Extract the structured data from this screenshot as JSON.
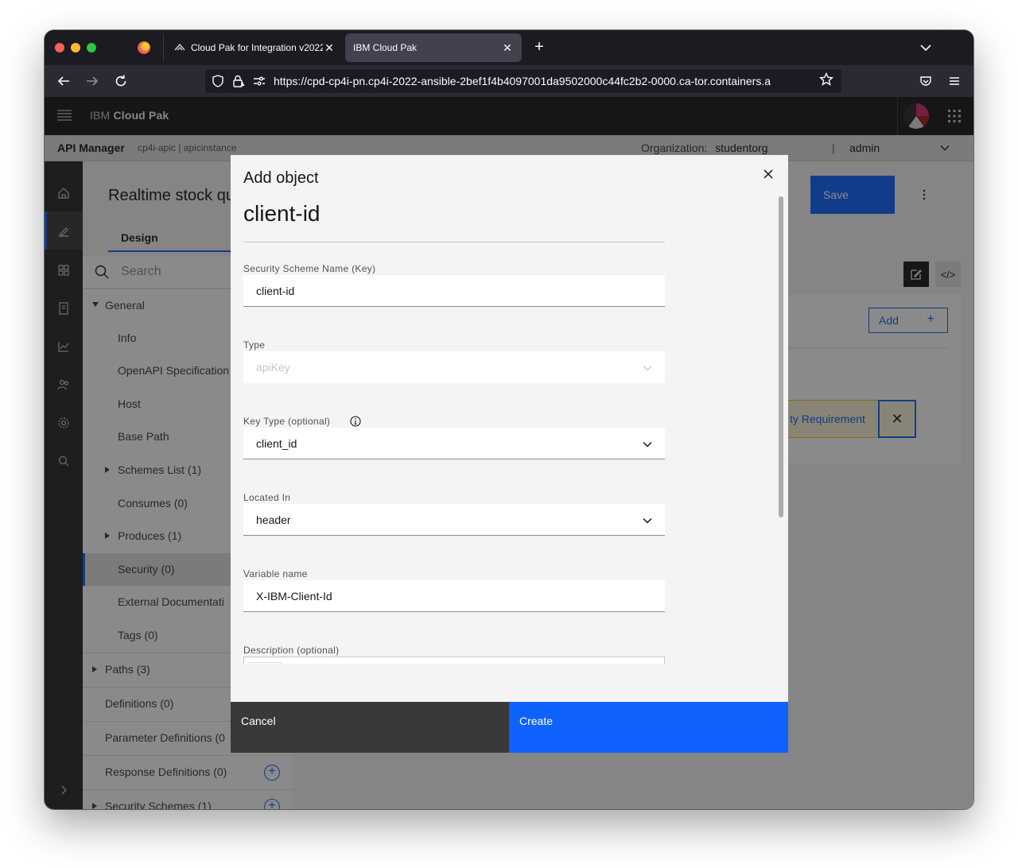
{
  "browser": {
    "tabs": [
      {
        "title": "Cloud Pak for Integration v2022",
        "active": false
      },
      {
        "title": "IBM Cloud Pak",
        "active": true
      }
    ],
    "url": "https://cpd-cp4i-pn.cp4i-2022-ansible-2bef1f4b4097001da9502000c44fc2b2-0000.ca-tor.containers.a"
  },
  "app": {
    "brand_prefix": "IBM",
    "brand_name": "Cloud Pak",
    "sub_header": {
      "app_name": "API Manager",
      "crumbs": "cp4i-apic  |  apicinstance",
      "org_label": "Organization:",
      "org_value": "studentorg",
      "pipe": "|",
      "user": "admin"
    },
    "page_title": "Realtime stock qu",
    "design_tab": "Design",
    "save_label": "Save",
    "search_placeholder": "Search",
    "nav": [
      {
        "label": "General",
        "level": 0,
        "caret": "down"
      },
      {
        "label": "Info",
        "level": 1
      },
      {
        "label": "OpenAPI Specification",
        "level": 1
      },
      {
        "label": "Host",
        "level": 1
      },
      {
        "label": "Base Path",
        "level": 1
      },
      {
        "label": "Schemes List (1)",
        "level": 1,
        "caret": "right"
      },
      {
        "label": "Consumes (0)",
        "level": 1
      },
      {
        "label": "Produces (1)",
        "level": 1,
        "caret": "right"
      },
      {
        "label": "Security (0)",
        "level": 1,
        "selected": true
      },
      {
        "label": "External Documentati",
        "level": 1
      },
      {
        "label": "Tags (0)",
        "level": 1
      },
      {
        "label": "Paths (3)",
        "level": 0,
        "caret": "right"
      },
      {
        "label": "Definitions (0)",
        "level": 0
      },
      {
        "label": "Parameter Definitions (0",
        "level": 0
      },
      {
        "label": "Response Definitions (0)",
        "level": 0,
        "add": true
      },
      {
        "label": "Security Schemes (1)",
        "level": 0,
        "caret": "right",
        "add": true
      }
    ],
    "add_label": "Add",
    "add_plus": "+",
    "requirement_label": "ty Requirement",
    "requirement_close": "✕"
  },
  "modal": {
    "label": "Add object",
    "heading": "client-id",
    "fields": {
      "scheme_name": {
        "label": "Security Scheme Name (Key)",
        "value": "client-id"
      },
      "type": {
        "label": "Type",
        "value": "apiKey"
      },
      "key_type": {
        "label": "Key Type (optional)",
        "value": "client_id"
      },
      "located_in": {
        "label": "Located In",
        "value": "header"
      },
      "variable_name": {
        "label": "Variable name",
        "value": "X-IBM-Client-Id"
      },
      "description": {
        "label": "Description (optional)"
      }
    },
    "cancel_label": "Cancel",
    "create_label": "Create"
  }
}
